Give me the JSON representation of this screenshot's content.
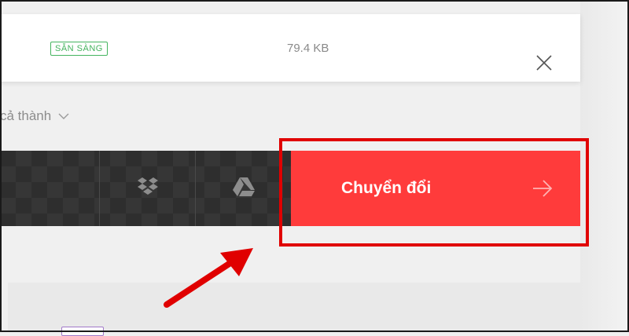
{
  "file": {
    "status": "SẴN SÀNG",
    "size": "79.4 KB",
    "close_icon": "close-icon"
  },
  "settings": {
    "label": "cả thành",
    "chevron_icon": "chevron-down-icon"
  },
  "toolbar": {
    "tools": [
      {
        "name": "dropbox",
        "icon": "dropbox-icon"
      },
      {
        "name": "google-drive",
        "icon": "google-drive-icon"
      }
    ]
  },
  "convert": {
    "label": "Chuyển đổi",
    "icon": "arrow-right-icon"
  },
  "colors": {
    "accent": "#ff3b3b",
    "status_green": "#45b45f",
    "toolbar_bg": "#2e2e2e",
    "annotation_red": "#e00000"
  }
}
